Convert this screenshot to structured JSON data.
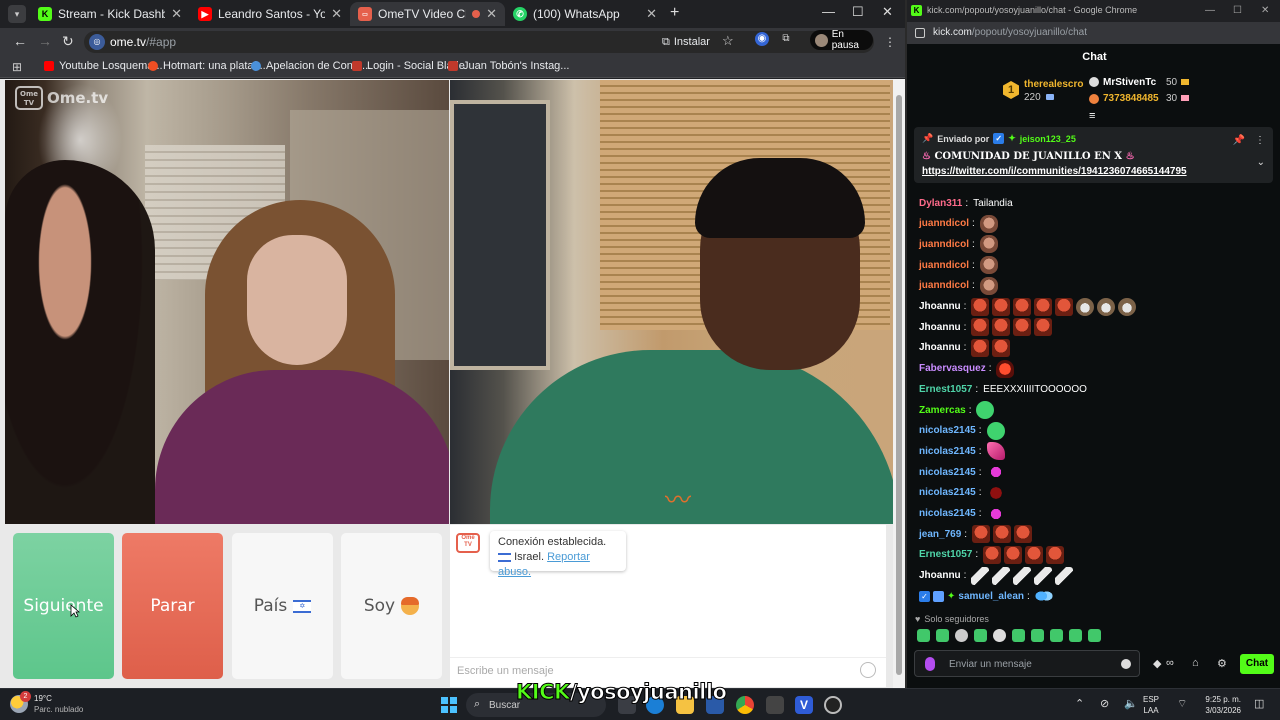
{
  "browser": {
    "tabs": [
      {
        "label": "Stream - Kick Dashboard",
        "favicon": "kick-icon",
        "color": "#53fc18"
      },
      {
        "label": "Leandro Santos - YouTube",
        "favicon": "youtube-icon",
        "color": "#ff0000"
      },
      {
        "label": "OmeTV Video Chat — Ome",
        "favicon": "ometv-icon",
        "color": "#e5604c"
      },
      {
        "label": "(100) WhatsApp",
        "favicon": "whatsapp-icon",
        "color": "#25d366"
      }
    ],
    "url_host": "ome.tv",
    "url_path": "/#app",
    "install_label": "Instalar",
    "profile_label": "En pausa",
    "bookmarks": [
      {
        "label": "Youtube Losquema...",
        "color": "#ff0000"
      },
      {
        "label": "Hotmart: una plataf...",
        "color": "#f04e23"
      },
      {
        "label": "Apelacion de Conte...",
        "color": "#4a90d9"
      },
      {
        "label": "Login - Social Blade",
        "color": "#c0392b"
      },
      {
        "label": "Juan Tobón's Instag...",
        "color": "#c0392b"
      }
    ]
  },
  "ometv": {
    "logo_text": "Ome.tv",
    "logo_box_text": "Ome TV",
    "buttons": {
      "next": "Siguiente",
      "stop": "Parar",
      "country": "País",
      "gender": "Soy"
    },
    "system_message": {
      "line1": "Conexión establecida.",
      "country": "Israel.",
      "report": "Reportar abuso."
    },
    "input_placeholder": "Escribe un mensaje"
  },
  "kick": {
    "window_title": "kick.com/popout/yosoyjuanillo/chat - Google Chrome",
    "url_host": "kick.com",
    "url_path": "/popout/yosoyjuanillo/chat",
    "chat_title": "Chat",
    "leaders": [
      {
        "name": "therealescro",
        "value": "220",
        "rank": "1",
        "color": "#f0b62e"
      },
      {
        "name": "MrStivenTc",
        "value": "50",
        "color": "#ffffff"
      },
      {
        "name": "7373848485",
        "value": "30",
        "color": "#f0b62e"
      }
    ],
    "pinned": {
      "sent_by": "Enviado por",
      "user": "jeison123_25",
      "title": "COMUNIDAD DE JUANILLO EN X",
      "link": "https://twitter.com/i/communities/1941236074665144795"
    },
    "messages": [
      {
        "user": "Dylan311",
        "color": "#ff6b8b",
        "text": "Tailandia",
        "emotes": []
      },
      {
        "user": "juanndicol",
        "color": "#ff7a45",
        "text": "",
        "emotes": [
          "face"
        ]
      },
      {
        "user": "juanndicol",
        "color": "#ff7a45",
        "text": "",
        "emotes": [
          "face"
        ]
      },
      {
        "user": "juanndicol",
        "color": "#ff7a45",
        "text": "",
        "emotes": [
          "face"
        ]
      },
      {
        "user": "juanndicol",
        "color": "#ff7a45",
        "text": "",
        "emotes": [
          "face"
        ]
      },
      {
        "user": "Jhoannu",
        "color": "#ffffff",
        "text": "",
        "emotes": [
          "red",
          "red",
          "red",
          "red",
          "red",
          "cat",
          "cat",
          "cat"
        ]
      },
      {
        "user": "Jhoannu",
        "color": "#ffffff",
        "text": "",
        "emotes": [
          "red",
          "red",
          "red",
          "red"
        ]
      },
      {
        "user": "Jhoannu",
        "color": "#ffffff",
        "text": "",
        "emotes": [
          "red",
          "red"
        ]
      },
      {
        "user": "Fabervasquez",
        "color": "#c98cff",
        "text": "",
        "emotes": [
          "mask"
        ]
      },
      {
        "user": "Ernest1057",
        "color": "#4fd4a8",
        "text": "EEEXXXIIIITOOOOOO",
        "emotes": []
      },
      {
        "user": "Zamercas",
        "color": "#53fc18",
        "text": "",
        "emotes": [
          "green"
        ]
      },
      {
        "user": "nicolas2145",
        "color": "#6fb7ff",
        "text": "",
        "emotes": [
          "green"
        ]
      },
      {
        "user": "nicolas2145",
        "color": "#6fb7ff",
        "text": "",
        "emotes": [
          "pink"
        ]
      },
      {
        "user": "nicolas2145",
        "color": "#6fb7ff",
        "text": "",
        "emotes": [
          "magenta"
        ]
      },
      {
        "user": "nicolas2145",
        "color": "#6fb7ff",
        "text": "",
        "emotes": [
          "darkred"
        ]
      },
      {
        "user": "nicolas2145",
        "color": "#6fb7ff",
        "text": "",
        "emotes": [
          "magenta"
        ]
      },
      {
        "user": "jean_769",
        "color": "#6fb7ff",
        "text": "",
        "emotes": [
          "red",
          "red",
          "red"
        ]
      },
      {
        "user": "Ernest1057",
        "color": "#4fd4a8",
        "text": "",
        "emotes": [
          "red",
          "red",
          "red",
          "red"
        ]
      },
      {
        "user": "Jhoannu",
        "color": "#ffffff",
        "text": "",
        "emotes": [
          "feather",
          "feather",
          "feather",
          "feather",
          "feather"
        ]
      },
      {
        "user": "samuel_alean",
        "color": "#6fb7ff",
        "text": "",
        "emotes": [
          "butterfly"
        ]
      }
    ],
    "followers_only": "Solo seguidores",
    "input_placeholder": "Enviar un mensaje",
    "send_label": "Chat"
  },
  "taskbar": {
    "temperature": "19°C",
    "weather": "Parc. nublado",
    "weather_badge": "2",
    "search_placeholder": "Buscar",
    "lang_top": "ESP",
    "lang_bottom": "LAA",
    "time": "9:25 p. m.",
    "date": "3/03/2026"
  },
  "overlay": {
    "brand": "KICK",
    "handle": "/yosoyjuanillo"
  }
}
